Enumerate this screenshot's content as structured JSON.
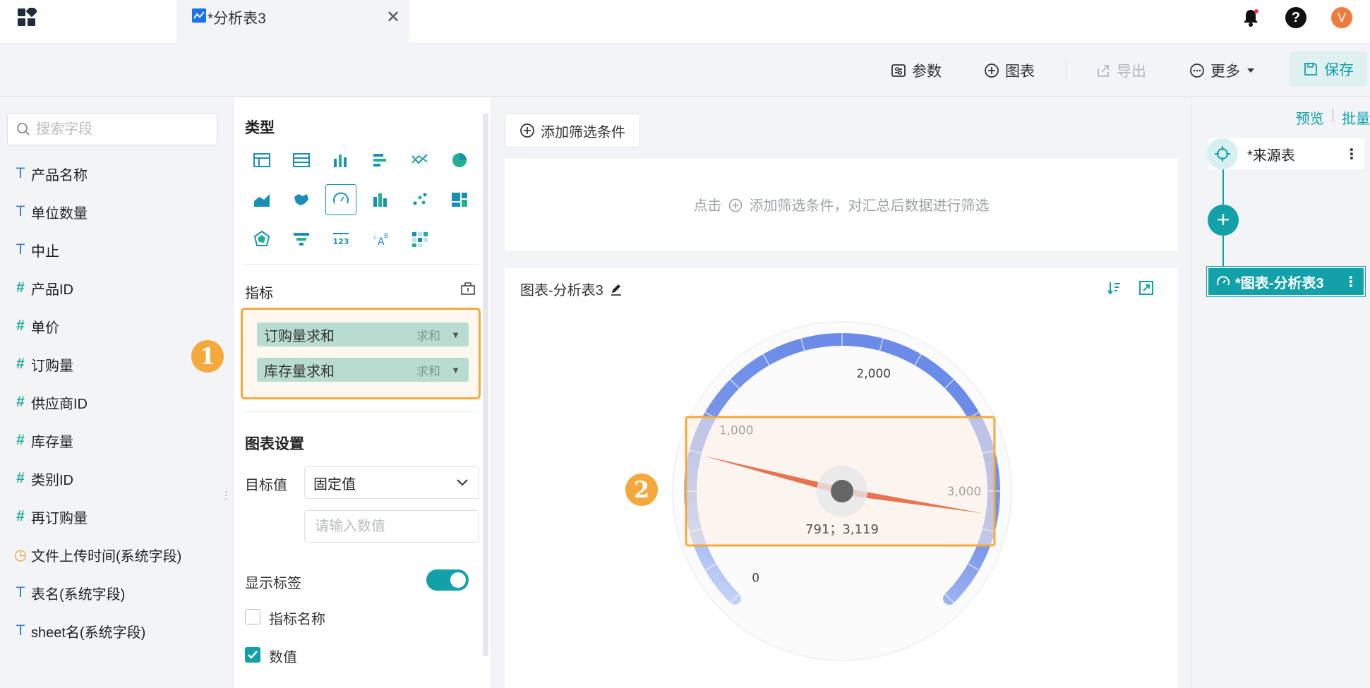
{
  "tab": {
    "title": "*分析表3",
    "close": "✕"
  },
  "toolbar": {
    "params": "参数",
    "chart": "图表",
    "export": "导出",
    "more": "更多",
    "save": "保存"
  },
  "avatar_letter": "V",
  "help_label": "?",
  "fields": {
    "search_placeholder": "搜索字段",
    "items": [
      {
        "type": "T",
        "label": "产品名称"
      },
      {
        "type": "T",
        "label": "单位数量"
      },
      {
        "type": "T",
        "label": "中止"
      },
      {
        "type": "#",
        "label": "产品ID"
      },
      {
        "type": "#",
        "label": "单价"
      },
      {
        "type": "#",
        "label": "订购量"
      },
      {
        "type": "#",
        "label": "供应商ID"
      },
      {
        "type": "#",
        "label": "库存量"
      },
      {
        "type": "#",
        "label": "类别ID"
      },
      {
        "type": "#",
        "label": "再订购量"
      },
      {
        "type": "clock",
        "label": "文件上传时间(系统字段)"
      },
      {
        "type": "T",
        "label": "表名(系统字段)"
      },
      {
        "type": "T",
        "label": "sheet名(系统字段)"
      }
    ]
  },
  "annotations": {
    "one": "1",
    "two": "2"
  },
  "config": {
    "type_title": "类型",
    "metrics_title": "指标",
    "metrics": [
      {
        "label": "订购量求和",
        "agg": "求和"
      },
      {
        "label": "库存量求和",
        "agg": "求和"
      }
    ],
    "chart_settings_title": "图表设置",
    "target_label": "目标值",
    "target_select": "固定值",
    "target_placeholder": "请输入数值",
    "show_label": "显示标签",
    "metric_name": "指标名称",
    "value": "数值"
  },
  "canvas": {
    "add_filter": "添加筛选条件",
    "filter_hint_prefix": "点击",
    "filter_hint_suffix": "添加筛选条件，对汇总后数据进行筛选",
    "chart_title": "图表-分析表3"
  },
  "flow": {
    "preview": "预览",
    "batch": "批量",
    "source": "*来源表",
    "chart_node": "*图表-分析表3"
  },
  "colors": {
    "accent": "#12a1a8",
    "highlight": "#f5a93c",
    "gauge_band": "#6b8be8",
    "needle": "#e8734f"
  },
  "gauge": {
    "ticks": [
      "0",
      "1,000",
      "2,000",
      "3,000"
    ],
    "max": 3600,
    "values": [
      791,
      3119
    ],
    "value_label": "791；3,119"
  }
}
